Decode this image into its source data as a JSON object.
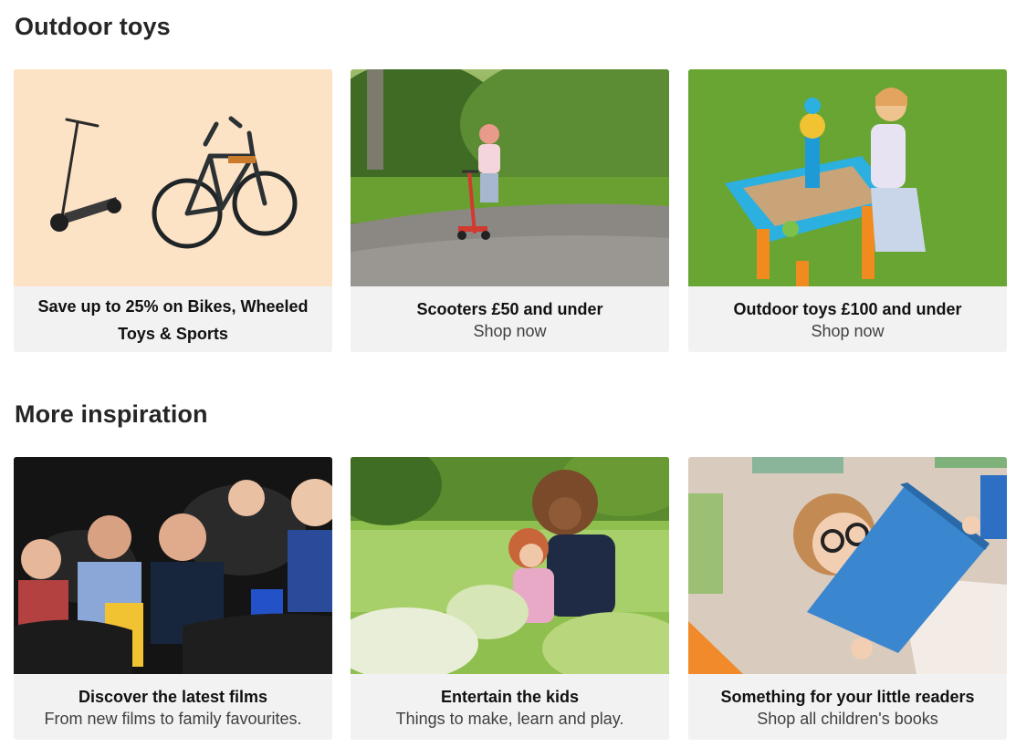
{
  "sections": [
    {
      "title": "Outdoor toys",
      "cards": [
        {
          "title": "Save up to 25% on Bikes, Wheeled Toys & Sports",
          "subtitle": "",
          "image": "scooter-and-bike-image"
        },
        {
          "title": "Scooters £50 and under",
          "subtitle": "Shop now",
          "image": "child-on-scooter-image"
        },
        {
          "title": "Outdoor toys £100 and under",
          "subtitle": "Shop now",
          "image": "child-water-table-image"
        }
      ]
    },
    {
      "title": "More inspiration",
      "cards": [
        {
          "title": "Discover the latest films",
          "subtitle": "From new films to family favourites.",
          "image": "cinema-audience-image"
        },
        {
          "title": "Entertain the kids",
          "subtitle": "Things to make, learn and play.",
          "image": "kids-gardening-image"
        },
        {
          "title": "Something for your little readers",
          "subtitle": "Shop all children's books",
          "image": "girl-reading-book-image"
        }
      ]
    }
  ],
  "colors": {
    "page_background": "#ffffff",
    "caption_background": "#f2f2f2",
    "promo_peach": "#fde3c6"
  }
}
